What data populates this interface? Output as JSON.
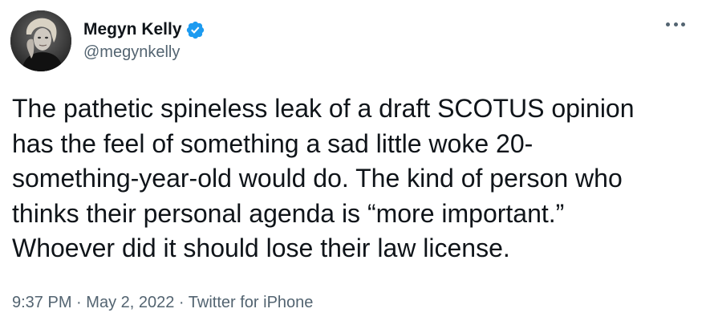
{
  "author": {
    "display_name": "Megyn Kelly",
    "handle": "@megynkelly",
    "verified": true,
    "avatar_icon": "profile-photo"
  },
  "tweet": {
    "text_lines": [
      "The pathetic spineless leak of a draft SCOTUS opinion",
      "has the feel of something a sad little woke 20-",
      "something-year-old would do. The kind of person who",
      "thinks their personal agenda is “more important.”",
      "Whoever did it should lose their law license."
    ]
  },
  "meta": {
    "time": "9:37 PM",
    "separator": "·",
    "date": "May 2, 2022",
    "source": "Twitter for iPhone"
  },
  "icons": {
    "more": "more-options-icon",
    "verified": "verified-badge-icon"
  },
  "colors": {
    "text_primary": "#0f1419",
    "text_secondary": "#536471",
    "verified_blue": "#1d9bf0"
  }
}
